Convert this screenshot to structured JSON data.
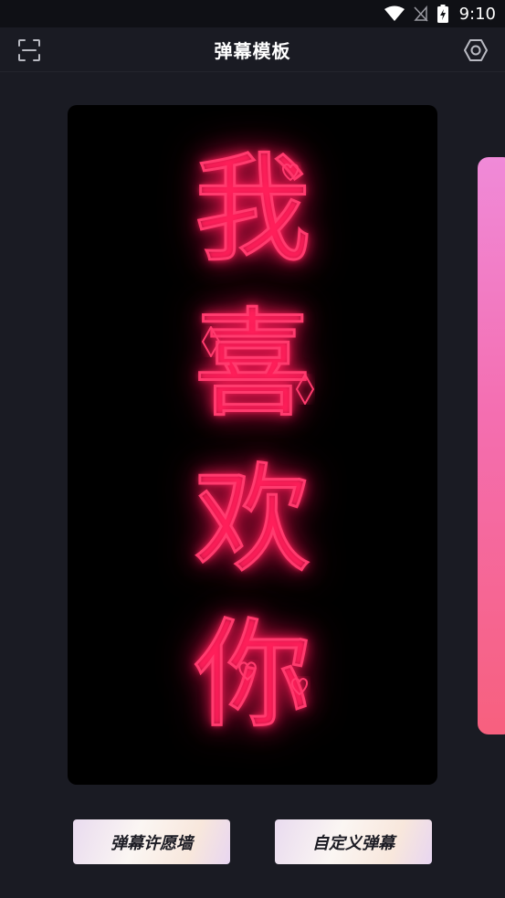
{
  "status_bar": {
    "time": "9:10",
    "icons": [
      "wifi-icon",
      "no-signal-icon",
      "battery-charging-icon"
    ]
  },
  "app_bar": {
    "title": "弹幕模板",
    "left_icon": "scan-icon",
    "right_icon": "settings-icon"
  },
  "template_card": {
    "characters": [
      "我",
      "喜",
      "欢",
      "你"
    ],
    "neon_color": "#ff3b6e"
  },
  "buttons": {
    "wish_wall": "弹幕许愿墙",
    "custom": "自定义弹幕"
  }
}
